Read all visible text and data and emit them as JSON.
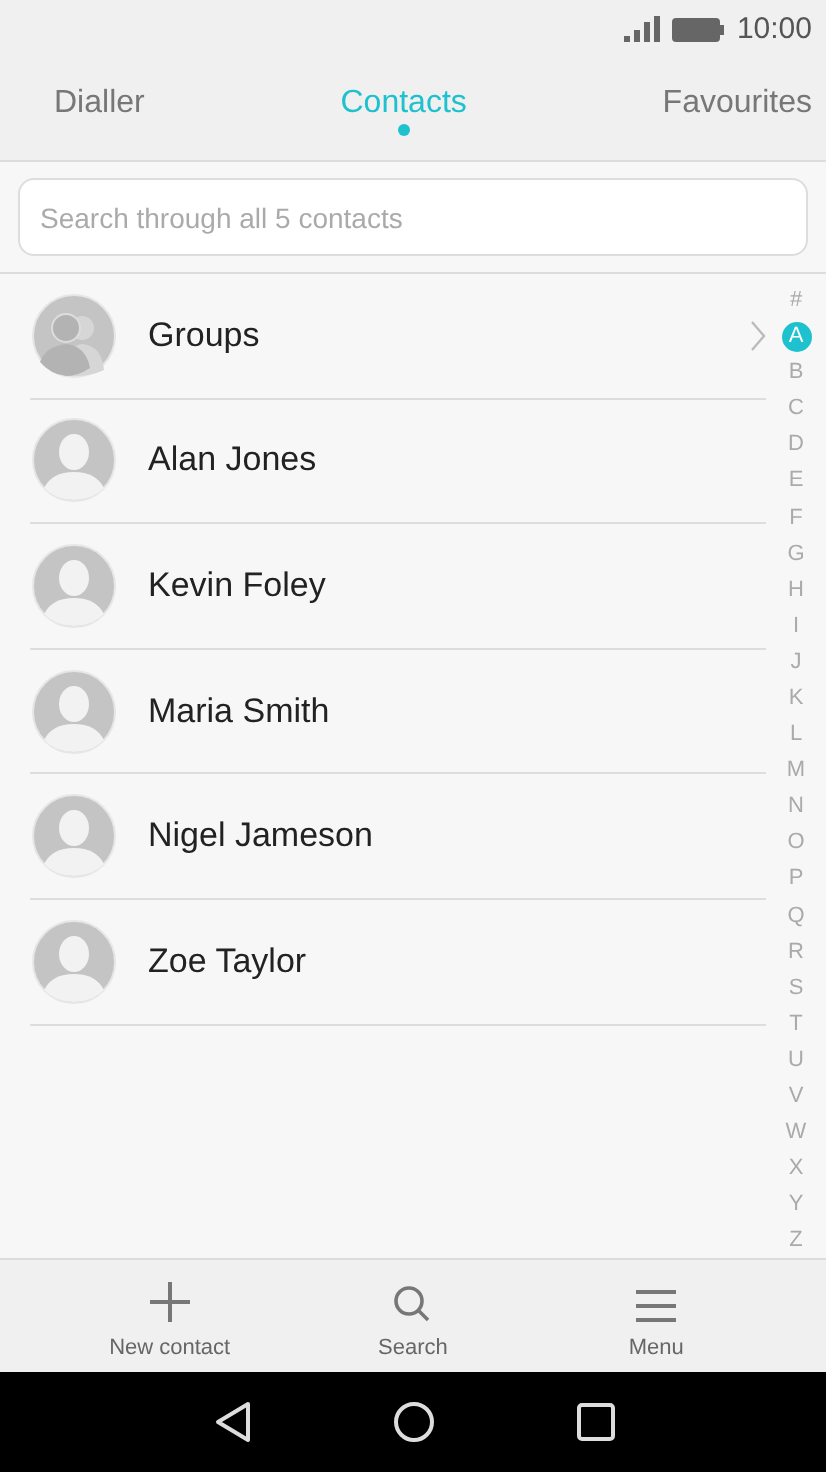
{
  "status_bar": {
    "time": "10:00"
  },
  "tabs": [
    {
      "label": "Dialler",
      "selected": false
    },
    {
      "label": "Contacts",
      "selected": true
    },
    {
      "label": "Favourites",
      "selected": false
    }
  ],
  "search": {
    "placeholder": "Search through all 5 contacts"
  },
  "contacts": [
    {
      "kind": "group",
      "name": "Groups"
    },
    {
      "kind": "contact",
      "name": "Alan Jones"
    },
    {
      "kind": "contact",
      "name": "Kevin Foley"
    },
    {
      "kind": "contact",
      "name": "Maria Smith"
    },
    {
      "kind": "contact",
      "name": "Nigel Jameson"
    },
    {
      "kind": "contact",
      "name": "Zoe Taylor"
    }
  ],
  "index": [
    {
      "label": "#",
      "selected": false
    },
    {
      "label": "A",
      "selected": true
    },
    {
      "label": "B",
      "selected": false
    },
    {
      "label": "C",
      "selected": false
    },
    {
      "label": "D",
      "selected": false
    },
    {
      "label": "E",
      "selected": false
    },
    {
      "label": "F",
      "selected": false
    },
    {
      "label": "G",
      "selected": false
    },
    {
      "label": "H",
      "selected": false
    },
    {
      "label": "I",
      "selected": false
    },
    {
      "label": "J",
      "selected": false
    },
    {
      "label": "K",
      "selected": false
    },
    {
      "label": "L",
      "selected": false
    },
    {
      "label": "M",
      "selected": false
    },
    {
      "label": "N",
      "selected": false
    },
    {
      "label": "O",
      "selected": false
    },
    {
      "label": "P",
      "selected": false
    },
    {
      "label": "Q",
      "selected": false
    },
    {
      "label": "R",
      "selected": false
    },
    {
      "label": "S",
      "selected": false
    },
    {
      "label": "T",
      "selected": false
    },
    {
      "label": "U",
      "selected": false
    },
    {
      "label": "V",
      "selected": false
    },
    {
      "label": "W",
      "selected": false
    },
    {
      "label": "X",
      "selected": false
    },
    {
      "label": "Y",
      "selected": false
    },
    {
      "label": "Z",
      "selected": false
    }
  ],
  "bottom_bar": [
    {
      "kind": "add",
      "label": "New contact"
    },
    {
      "kind": "search",
      "label": "Search"
    },
    {
      "kind": "menu",
      "label": "Menu"
    }
  ]
}
